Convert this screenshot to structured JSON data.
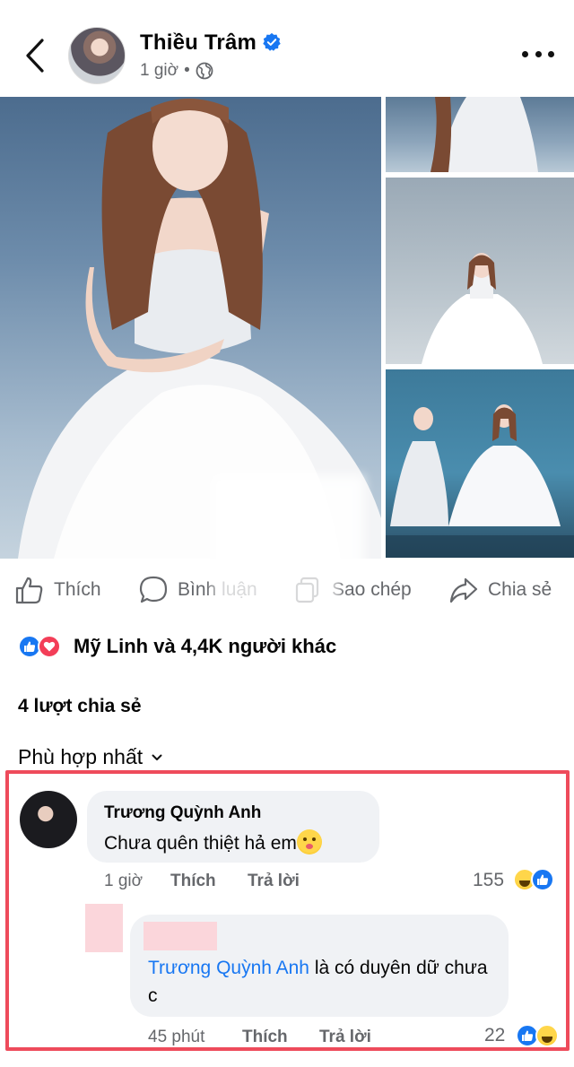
{
  "post": {
    "author": "Thiều Trâm",
    "time": "1 giờ",
    "separator": "•"
  },
  "actions": {
    "like": "Thích",
    "comment": "Bình luận",
    "copy": "Sao chép",
    "share": "Chia sẻ"
  },
  "reactions_summary": "Mỹ Linh và 4,4K người khác",
  "shares": "4 lượt chia sẻ",
  "sort_label": "Phù hợp nhất",
  "comment": {
    "name": "Trương Quỳnh Anh",
    "text": "Chưa quên thiệt hả em",
    "time": "1 giờ",
    "like": "Thích",
    "reply": "Trả lời",
    "reaction_count": "155"
  },
  "reply": {
    "mention": "Trương Quỳnh Anh",
    "text": " là có duyên dữ chưa c",
    "time": "45 phút",
    "like": "Thích",
    "reply": "Trả lời",
    "reaction_count": "22"
  },
  "colors": {
    "accent": "#1877f2",
    "highlight": "#ee4b5b",
    "muted": "#65676b"
  }
}
